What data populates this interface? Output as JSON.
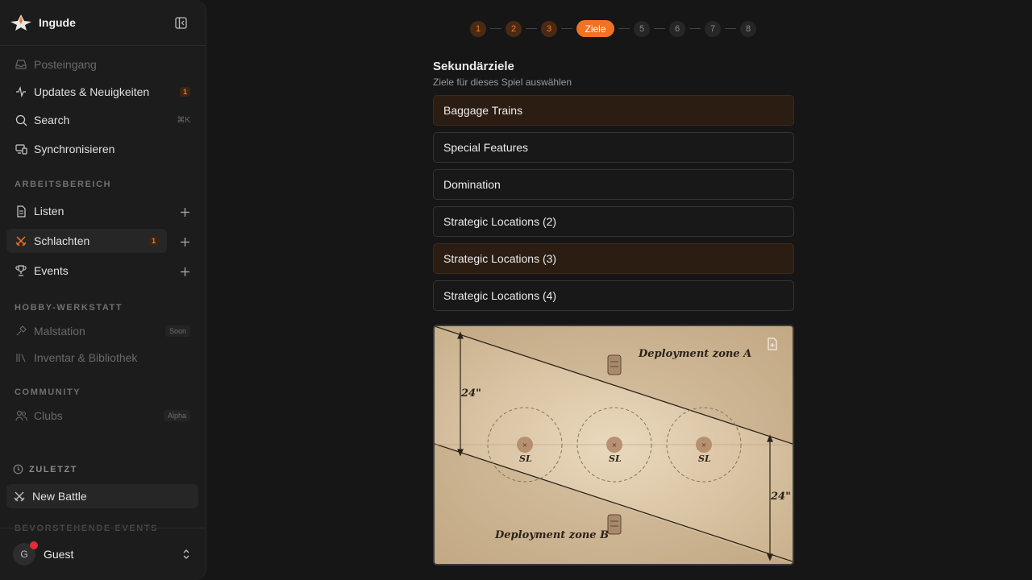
{
  "app": {
    "name": "Ingude"
  },
  "sidebar": {
    "top_items": [
      {
        "label": "Posteingang",
        "icon": "inbox-icon"
      },
      {
        "label": "Updates & Neuigkeiten",
        "icon": "activity-icon",
        "badge": "1"
      },
      {
        "label": "Search",
        "icon": "search-icon",
        "shortcut": "⌘K"
      },
      {
        "label": "Synchronisieren",
        "icon": "devices-icon"
      }
    ],
    "workspace_label": "ARBEITSBEREICH",
    "workspace_items": [
      {
        "label": "Listen",
        "icon": "document-icon"
      },
      {
        "label": "Schlachten",
        "icon": "crossed-swords-icon",
        "badge": "1"
      },
      {
        "label": "Events",
        "icon": "trophy-icon"
      }
    ],
    "hobby_label": "HOBBY-WERKSTATT",
    "hobby_items": [
      {
        "label": "Malstation",
        "icon": "brush-icon",
        "tag": "Soon"
      },
      {
        "label": "Inventar & Bibliothek",
        "icon": "library-icon"
      }
    ],
    "community_label": "COMMUNITY",
    "community_items": [
      {
        "label": "Clubs",
        "icon": "users-icon",
        "tag": "Alpha"
      }
    ],
    "recent_label": "ZULETZT",
    "recent_items": [
      {
        "label": "New Battle",
        "icon": "crossed-swords-icon"
      }
    ],
    "upcoming_label": "BEVORSTEHENDE EVENTS",
    "user": {
      "initial": "G",
      "name": "Guest"
    }
  },
  "stepper": {
    "steps": [
      "1",
      "2",
      "3",
      "Ziele",
      "5",
      "6",
      "7",
      "8"
    ],
    "current_index": 3
  },
  "main": {
    "title": "Sekundärziele",
    "subtitle": "Ziele für dieses Spiel auswählen",
    "objectives": [
      {
        "label": "Baggage Trains",
        "selected": true
      },
      {
        "label": "Special Features",
        "selected": false
      },
      {
        "label": "Domination",
        "selected": false
      },
      {
        "label": "Strategic Locations (2)",
        "selected": false
      },
      {
        "label": "Strategic Locations (3)",
        "selected": true
      },
      {
        "label": "Strategic Locations (4)",
        "selected": false
      }
    ],
    "map": {
      "zone_a": "Deployment zone A",
      "zone_b": "Deployment zone B",
      "dist_left": "24\"",
      "dist_right": "24\"",
      "sl_label": "SL"
    }
  },
  "colors": {
    "accent": "#f27224",
    "selected_bg": "#2c1d13",
    "background": "#161616"
  }
}
